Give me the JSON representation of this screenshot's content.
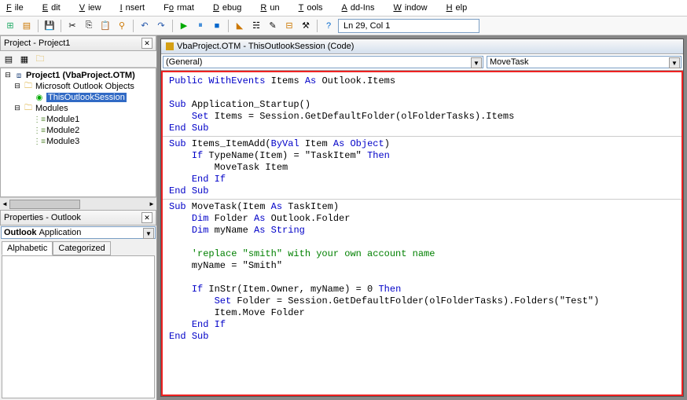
{
  "menu": {
    "file": "File",
    "edit": "Edit",
    "view": "View",
    "insert": "Insert",
    "format": "Format",
    "debug": "Debug",
    "run": "Run",
    "tools": "Tools",
    "addins": "Add-Ins",
    "window": "Window",
    "help": "Help"
  },
  "toolbar": {
    "cursor": "Ln 29, Col 1",
    "icons": [
      "view-ms",
      "view-form",
      "save",
      "cut",
      "copy",
      "paste",
      "find",
      "undo",
      "redo",
      "run",
      "pause",
      "stop",
      "design",
      "project-explorer",
      "properties",
      "object-browser",
      "toolbox",
      "order",
      "help"
    ]
  },
  "project_panel": {
    "title": "Project - Project1",
    "root": "Project1 (VbaProject.OTM)",
    "outlook_folder": "Microsoft Outlook Objects",
    "this_session": "ThisOutlookSession",
    "modules_folder": "Modules",
    "modules": [
      "Module1",
      "Module2",
      "Module3"
    ]
  },
  "properties_panel": {
    "title": "Properties - Outlook",
    "obj_bold": "Outlook",
    "obj_rest": "Application",
    "tabs": {
      "alpha": "Alphabetic",
      "cat": "Categorized"
    }
  },
  "code_window": {
    "title": "VbaProject.OTM - ThisOutlookSession (Code)",
    "left_combo": "(General)",
    "right_combo": "MoveTask",
    "lines": [
      {
        "t": "Public WithEvents Items As Outlook.Items",
        "kw": [
          "Public",
          "WithEvents",
          "As"
        ]
      },
      {
        "t": ""
      },
      {
        "t": "Sub Application_Startup()",
        "kw": [
          "Sub"
        ]
      },
      {
        "t": "    Set Items = Session.GetDefaultFolder(olFolderTasks).Items",
        "kw": [
          "Set"
        ]
      },
      {
        "t": "End Sub",
        "kw": [
          "End",
          "Sub"
        ]
      },
      {
        "hr": true
      },
      {
        "t": "Sub Items_ItemAdd(ByVal Item As Object)",
        "kw": [
          "Sub",
          "ByVal",
          "As",
          "Object"
        ]
      },
      {
        "t": "    If TypeName(Item) = \"TaskItem\" Then",
        "kw": [
          "If",
          "Then"
        ]
      },
      {
        "t": "        MoveTask Item"
      },
      {
        "t": "    End If",
        "kw": [
          "End",
          "If"
        ]
      },
      {
        "t": "End Sub",
        "kw": [
          "End",
          "Sub"
        ]
      },
      {
        "hr": true
      },
      {
        "t": "Sub MoveTask(Item As TaskItem)",
        "kw": [
          "Sub",
          "As"
        ]
      },
      {
        "t": "    Dim Folder As Outlook.Folder",
        "kw": [
          "Dim",
          "As"
        ]
      },
      {
        "t": "    Dim myName As String",
        "kw": [
          "Dim",
          "As",
          "String"
        ]
      },
      {
        "t": ""
      },
      {
        "t": "    'replace \"smith\" with your own account name",
        "cm": true
      },
      {
        "t": "    myName = \"Smith\""
      },
      {
        "t": ""
      },
      {
        "t": "    If InStr(Item.Owner, myName) = 0 Then",
        "kw": [
          "If",
          "Then"
        ]
      },
      {
        "t": "        Set Folder = Session.GetDefaultFolder(olFolderTasks).Folders(\"Test\")",
        "kw": [
          "Set"
        ]
      },
      {
        "t": "        Item.Move Folder"
      },
      {
        "t": "    End If",
        "kw": [
          "End",
          "If"
        ]
      },
      {
        "t": "End Sub",
        "kw": [
          "End",
          "Sub"
        ]
      }
    ]
  }
}
